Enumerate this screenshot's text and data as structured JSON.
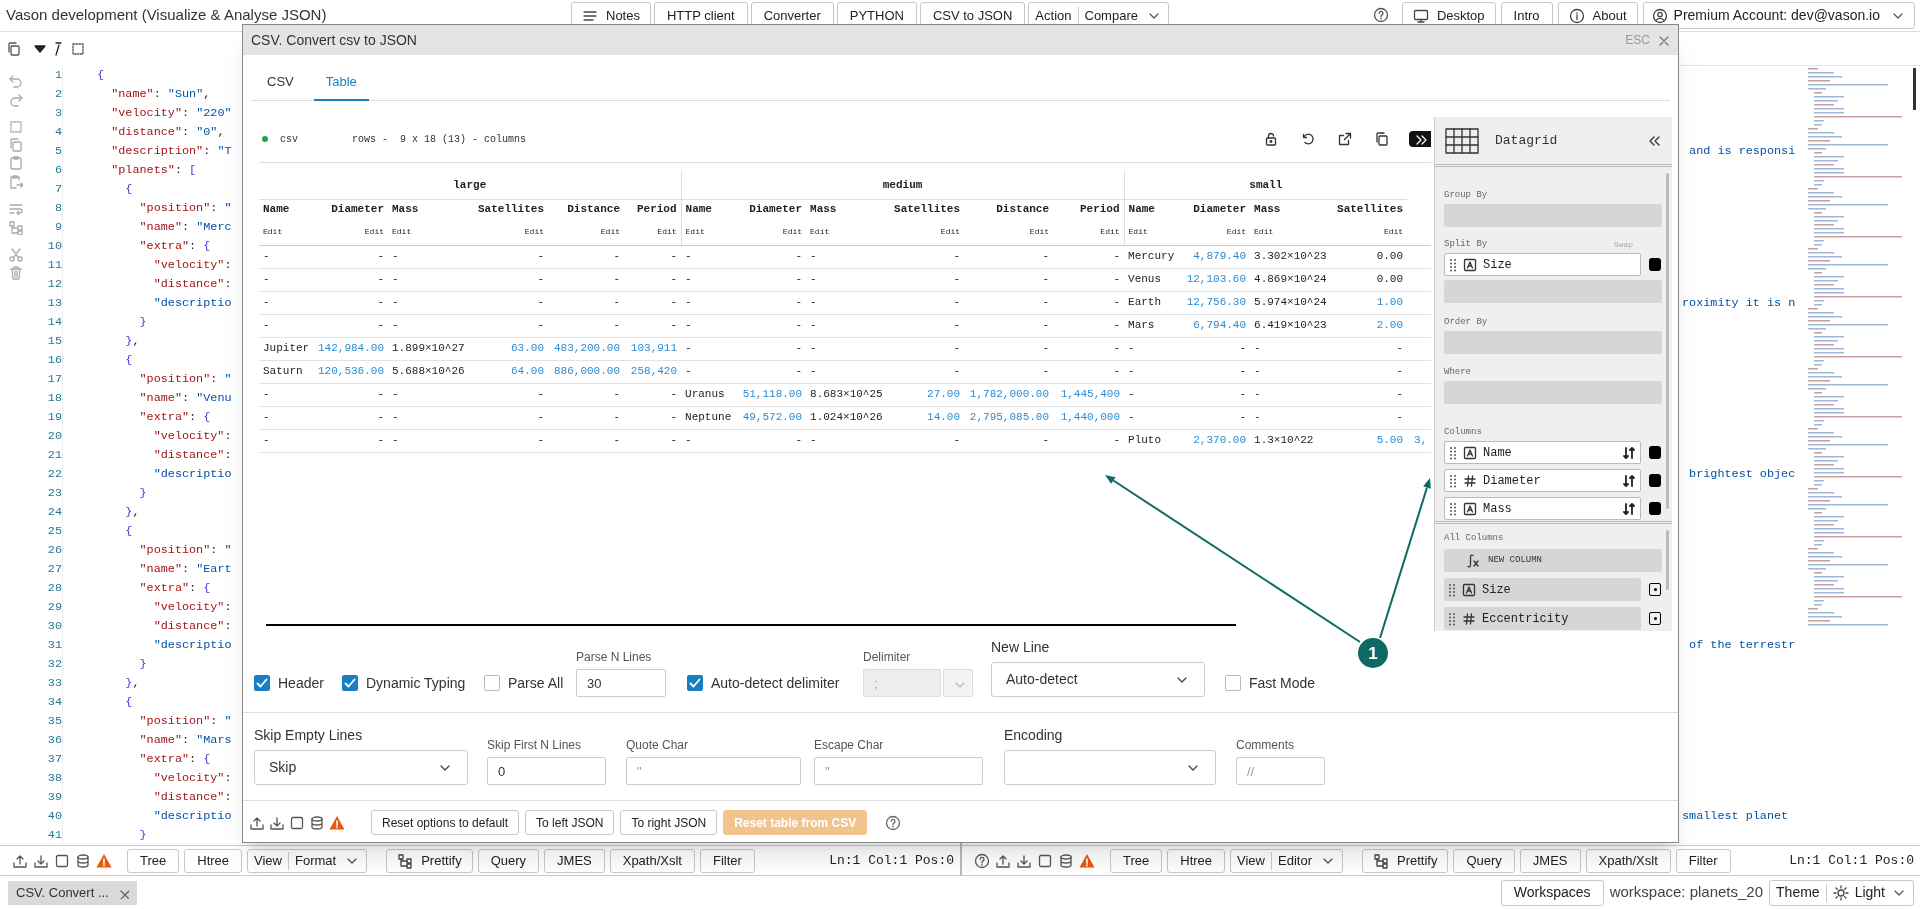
{
  "top_bar": {
    "title": "Vason development (Visualize & Analyse JSON)",
    "center_buttons": [
      {
        "label": "Notes",
        "kind": "icon"
      },
      {
        "label": "HTTP client",
        "kind": "plain"
      },
      {
        "label": "Converter",
        "kind": "plain"
      },
      {
        "label": "PYTHON",
        "kind": "plain"
      },
      {
        "label": "CSV to JSON",
        "kind": "plain"
      },
      {
        "label": "Action",
        "value": "Compare",
        "kind": "dropdown"
      }
    ],
    "right_buttons": [
      {
        "kind": "help"
      },
      {
        "label": "Desktop",
        "kind": "icon"
      },
      {
        "label": "Intro",
        "kind": "plain"
      },
      {
        "label": "About",
        "kind": "icon"
      },
      {
        "label": "Premium Account: dev@vason.io",
        "kind": "account"
      }
    ]
  },
  "left_editor": {
    "lines": [
      {
        "number": "1",
        "text": "{"
      },
      {
        "number": "2",
        "text": "  \"name\": \"Sun\","
      },
      {
        "number": "3",
        "text": "  \"velocity\": \"220\""
      },
      {
        "number": "4",
        "text": "  \"distance\": \"0\","
      },
      {
        "number": "5",
        "text": "  \"description\": \"T"
      },
      {
        "number": "6",
        "text": "  \"planets\": ["
      },
      {
        "number": "7",
        "text": "    {"
      },
      {
        "number": "8",
        "text": "      \"position\": \""
      },
      {
        "number": "9",
        "text": "      \"name\": \"Merc"
      },
      {
        "number": "10",
        "text": "      \"extra\": {"
      },
      {
        "number": "11",
        "text": "        \"velocity\":"
      },
      {
        "number": "12",
        "text": "        \"distance\":"
      },
      {
        "number": "13",
        "text": "        \"descriptio"
      },
      {
        "number": "14",
        "text": "      }"
      },
      {
        "number": "15",
        "text": "    },"
      },
      {
        "number": "16",
        "text": "    {"
      },
      {
        "number": "17",
        "text": "      \"position\": \""
      },
      {
        "number": "18",
        "text": "      \"name\": \"Venu"
      },
      {
        "number": "19",
        "text": "      \"extra\": {"
      },
      {
        "number": "20",
        "text": "        \"velocity\":"
      },
      {
        "number": "21",
        "text": "        \"distance\":"
      },
      {
        "number": "22",
        "text": "        \"descriptio"
      },
      {
        "number": "23",
        "text": "      }"
      },
      {
        "number": "24",
        "text": "    },"
      },
      {
        "number": "25",
        "text": "    {"
      },
      {
        "number": "26",
        "text": "      \"position\": \""
      },
      {
        "number": "27",
        "text": "      \"name\": \"Eart"
      },
      {
        "number": "28",
        "text": "      \"extra\": {"
      },
      {
        "number": "29",
        "text": "        \"velocity\":"
      },
      {
        "number": "30",
        "text": "        \"distance\":"
      },
      {
        "number": "31",
        "text": "        \"descriptio"
      },
      {
        "number": "32",
        "text": "      }"
      },
      {
        "number": "33",
        "text": "    },"
      },
      {
        "number": "34",
        "text": "    {"
      },
      {
        "number": "35",
        "text": "      \"position\": \""
      },
      {
        "number": "36",
        "text": "      \"name\": \"Mars"
      },
      {
        "number": "37",
        "text": "      \"extra\": {"
      },
      {
        "number": "38",
        "text": "        \"velocity\":"
      },
      {
        "number": "39",
        "text": "        \"distance\":"
      },
      {
        "number": "40",
        "text": "        \"descriptio"
      },
      {
        "number": "41",
        "text": "      }"
      }
    ],
    "bottom_buttons": [
      {
        "label": "Tree",
        "kind": "plain"
      },
      {
        "label": "Htree",
        "kind": "plain"
      },
      {
        "label": "View",
        "value": "Format",
        "kind": "dropdown"
      },
      {
        "label": "Prettify",
        "kind": "icon"
      },
      {
        "label": "Query",
        "kind": "plain"
      },
      {
        "label": "JMES",
        "kind": "plain"
      },
      {
        "label": "Xpath/Xslt",
        "kind": "plain"
      },
      {
        "label": "Filter",
        "kind": "plain"
      }
    ],
    "status": "Ln:1 Col:1 Pos:0"
  },
  "right_editor": {
    "fragments": [
      " and is responsi",
      "roximity it is n",
      " brightest objec",
      " of the terrestr",
      "smallest planet"
    ],
    "bottom_buttons": [
      {
        "label": "Tree",
        "kind": "plain"
      },
      {
        "label": "Htree",
        "kind": "plain"
      },
      {
        "label": "View",
        "value": "Editor",
        "kind": "dropdown"
      },
      {
        "label": "Prettify",
        "kind": "icon"
      },
      {
        "label": "Query",
        "kind": "plain"
      },
      {
        "label": "JMES",
        "kind": "plain"
      },
      {
        "label": "Xpath/Xslt",
        "kind": "plain"
      },
      {
        "label": "Filter",
        "kind": "plain"
      }
    ],
    "status": "Ln:1 Col:1 Pos:0"
  },
  "dialog": {
    "title": "CSV. Convert csv to JSON",
    "close_hint": "ESC",
    "tabs": [
      {
        "label": "CSV",
        "selected": false
      },
      {
        "label": "Table",
        "selected": true
      }
    ],
    "source_label": "csv",
    "summary": "rows -  9 x 18 (13) - columns",
    "table": {
      "groups": [
        {
          "label": "large",
          "columns": [
            {
              "name": "Name",
              "action": "Edit"
            },
            {
              "name": "Diameter",
              "action": "Edit"
            },
            {
              "name": "Mass",
              "action": "Edit"
            },
            {
              "name": "Satellites",
              "action": "Edit"
            },
            {
              "name": "Distance",
              "action": "Edit"
            },
            {
              "name": "Period",
              "action": "Edit"
            }
          ]
        },
        {
          "label": "medium",
          "columns": [
            {
              "name": "Name",
              "action": "Edit"
            },
            {
              "name": "Diameter",
              "action": "Edit"
            },
            {
              "name": "Mass",
              "action": "Edit"
            },
            {
              "name": "Satellites",
              "action": "Edit"
            },
            {
              "name": "Distance",
              "action": "Edit"
            },
            {
              "name": "Period",
              "action": "Edit"
            }
          ]
        },
        {
          "label": "small",
          "columns": [
            {
              "name": "Name",
              "action": "Edit"
            },
            {
              "name": "Diameter",
              "action": "Edit"
            },
            {
              "name": "Mass",
              "action": "Edit"
            },
            {
              "name": "Satellites",
              "action": "Edit"
            }
          ]
        }
      ],
      "rows": [
        {
          "cells": [
            "-",
            "-",
            "-",
            "-",
            "-",
            "-",
            "-",
            "-",
            "-",
            "-",
            "-",
            "-",
            "Mercury",
            {
              "value": "4,879.40",
              "kind": "number"
            },
            "3.302×10^23",
            "0.00"
          ]
        },
        {
          "cells": [
            "-",
            "-",
            "-",
            "-",
            "-",
            "-",
            "-",
            "-",
            "-",
            "-",
            "-",
            "-",
            "Venus",
            {
              "value": "12,103.60",
              "kind": "number"
            },
            "4.869×10^24",
            "0.00"
          ]
        },
        {
          "cells": [
            "-",
            "-",
            "-",
            "-",
            "-",
            "-",
            "-",
            "-",
            "-",
            "-",
            "-",
            "-",
            "Earth",
            {
              "value": "12,756.30",
              "kind": "number"
            },
            "5.974×10^24",
            {
              "value": "1.00",
              "kind": "number"
            }
          ]
        },
        {
          "cells": [
            "-",
            "-",
            "-",
            "-",
            "-",
            "-",
            "-",
            "-",
            "-",
            "-",
            "-",
            "-",
            "Mars",
            {
              "value": "6,794.40",
              "kind": "number"
            },
            "6.419×10^23",
            {
              "value": "2.00",
              "kind": "number"
            }
          ]
        },
        {
          "cells": [
            "Jupiter",
            {
              "value": "142,984.00",
              "kind": "number"
            },
            "1.899×10^27",
            {
              "value": "63.00",
              "kind": "number"
            },
            {
              "value": "483,200.00",
              "kind": "number"
            },
            {
              "value": "103,911",
              "kind": "number"
            },
            "-",
            "-",
            "-",
            "-",
            "-",
            "-",
            "-",
            "-",
            "-",
            "-"
          ]
        },
        {
          "cells": [
            "Saturn",
            {
              "value": "120,536.00",
              "kind": "number"
            },
            "5.688×10^26",
            {
              "value": "64.00",
              "kind": "number"
            },
            {
              "value": "886,000.00",
              "kind": "number"
            },
            {
              "value": "258,420",
              "kind": "number"
            },
            "-",
            "-",
            "-",
            "-",
            "-",
            "-",
            "-",
            "-",
            "-",
            "-"
          ]
        },
        {
          "cells": [
            "-",
            "-",
            "-",
            "-",
            "-",
            "-",
            "Uranus",
            {
              "value": "51,118.00",
              "kind": "number"
            },
            "8.683×10^25",
            {
              "value": "27.00",
              "kind": "number"
            },
            {
              "value": "1,782,000.00",
              "kind": "number"
            },
            {
              "value": "1,445,400",
              "kind": "number"
            },
            "-",
            "-",
            "-",
            "-"
          ]
        },
        {
          "cells": [
            "-",
            "-",
            "-",
            "-",
            "-",
            "-",
            "Neptune",
            {
              "value": "49,572.00",
              "kind": "number"
            },
            "1.024×10^26",
            {
              "value": "14.00",
              "kind": "number"
            },
            {
              "value": "2,795,085.00",
              "kind": "number"
            },
            {
              "value": "1,440,000",
              "kind": "number"
            },
            "-",
            "-",
            "-",
            "-"
          ]
        },
        {
          "cells": [
            "-",
            "-",
            "-",
            "-",
            "-",
            "-",
            "-",
            "-",
            "-",
            "-",
            "-",
            "-",
            "Pluto",
            {
              "value": "2,370.00",
              "kind": "number"
            },
            "1.3×10^22",
            {
              "value": "5.00",
              "kind": "number"
            },
            {
              "value": "3,",
              "kind": "number"
            }
          ]
        }
      ]
    },
    "datagrid": {
      "title": "Datagrid",
      "sections": [
        {
          "label": "Group By",
          "kind": "dropzone"
        },
        {
          "label": "Split By",
          "kind": "split",
          "action": "Swap",
          "items": [
            {
              "label": "Size",
              "kind": "text",
              "checked": true
            }
          ]
        },
        {
          "label": "Order By",
          "kind": "dropzone"
        },
        {
          "label": "Where",
          "kind": "dropzone"
        },
        {
          "label": "Columns",
          "kind": "list",
          "items": [
            {
              "label": "Name",
              "kind": "text",
              "checked": true
            },
            {
              "label": "Diameter",
              "kind": "number",
              "checked": true
            },
            {
              "label": "Mass",
              "kind": "text",
              "checked": true
            }
          ]
        }
      ],
      "all_columns": {
        "label": "All Columns",
        "new_column": "NEW COLUMN",
        "items": [
          {
            "label": "Size",
            "kind": "text"
          },
          {
            "label": "Eccentricity",
            "kind": "number"
          }
        ]
      }
    },
    "options_row_1": [
      {
        "kind": "checkbox",
        "label": "Header",
        "checked": true
      },
      {
        "kind": "checkbox",
        "label": "Dynamic Typing",
        "checked": true
      },
      {
        "kind": "checkbox",
        "label": "Parse All",
        "checked": false
      },
      {
        "kind": "input",
        "label": "Parse N Lines",
        "value": "30"
      },
      {
        "kind": "checkbox",
        "label": "Auto-detect delimiter",
        "checked": true
      },
      {
        "kind": "combo",
        "label": "Delimiter",
        "value": ";",
        "disabled": true
      },
      {
        "kind": "select",
        "label": "New Line",
        "value": "Auto-detect"
      },
      {
        "kind": "checkbox",
        "label": "Fast Mode",
        "checked": false
      }
    ],
    "options_row_2": [
      {
        "kind": "select",
        "label": "Skip Empty Lines",
        "value": "Skip"
      },
      {
        "kind": "input",
        "label": "Skip First N Lines",
        "value": "0"
      },
      {
        "kind": "input",
        "label": "Quote Char",
        "placeholder": "\""
      },
      {
        "kind": "input",
        "label": "Escape Char",
        "placeholder": "\""
      },
      {
        "kind": "select",
        "label": "Encoding"
      },
      {
        "kind": "input",
        "label": "Comments",
        "placeholder": "//"
      }
    ],
    "actions": [
      {
        "label": "Reset options to default",
        "kind": "default"
      },
      {
        "label": "To left JSON",
        "kind": "default"
      },
      {
        "label": "To right JSON",
        "kind": "default"
      },
      {
        "label": "Reset table from CSV",
        "kind": "primary"
      }
    ]
  },
  "annotation": {
    "label": "1"
  },
  "status_bar": {
    "tab": "CSV. Convert ...",
    "workspaces_button": "Workspaces",
    "workspace": "workspace: planets_20",
    "theme_label": "Theme",
    "theme_value": "Light"
  }
}
